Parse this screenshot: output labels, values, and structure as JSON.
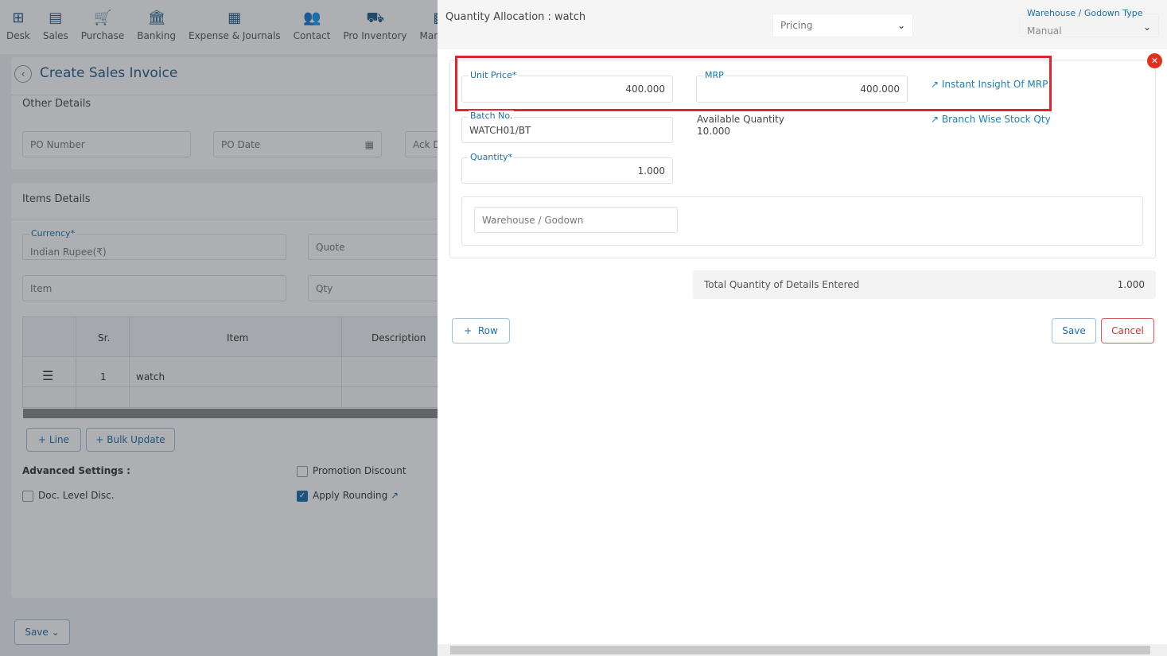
{
  "nav": [
    {
      "label": "Desk",
      "icon": "grid-plus-icon",
      "g": "⊞"
    },
    {
      "label": "Sales",
      "icon": "receipt-icon",
      "g": "▤"
    },
    {
      "label": "Purchase",
      "icon": "cart-icon",
      "g": "🛒"
    },
    {
      "label": "Banking",
      "icon": "bank-icon",
      "g": "🏛"
    },
    {
      "label": "Expense & Journals",
      "icon": "notebook-icon",
      "g": "▦"
    },
    {
      "label": "Contact",
      "icon": "users-icon",
      "g": "👥"
    },
    {
      "label": "Pro Inventory",
      "icon": "trolley-icon",
      "g": "⛟"
    },
    {
      "label": "Manufac",
      "icon": "factory-icon",
      "g": "▩"
    }
  ],
  "page": {
    "title": "Create Sales Invoice",
    "other_details": "Other Details",
    "po_number": "PO Number",
    "po_date": "PO Date",
    "ack": "Ack D",
    "items_details": "Items Details",
    "currency_label": "Currency",
    "currency_value": "Indian Rupee(₹)",
    "quote": "Quote",
    "item": "Item",
    "qty": "Qty",
    "table": {
      "headers": [
        "Sr.",
        "Item",
        "Description"
      ],
      "rows": [
        {
          "sr": "1",
          "item": "watch"
        }
      ]
    },
    "line_btn": "Line",
    "bulk_btn": "Bulk Update",
    "advanced": "Advanced Settings :",
    "promotion": "Promotion Discount",
    "doc_disc": "Doc. Level Disc.",
    "rounding": "Apply Rounding",
    "rounding_checked": true,
    "save": "Save"
  },
  "modal": {
    "title": "Quantity Allocation : watch",
    "pricing": "Pricing",
    "wh_type_label": "Warehouse / Godown Type",
    "wh_type_value": "Manual",
    "unit_price_label": "Unit Price",
    "unit_price": "400.000",
    "mrp_label": "MRP",
    "mrp": "400.000",
    "insight_link": "Instant Insight Of MRP",
    "batch_label": "Batch No.",
    "batch": "WATCH01/BT",
    "avail_label": "Available Quantity",
    "avail": "10.000",
    "branch_link": "Branch Wise Stock Qty",
    "qty_label": "Quantity",
    "qty": "1.000",
    "warehouse_placeholder": "Warehouse / Godown",
    "total_label": "Total Quantity of Details Entered",
    "total": "1.000",
    "row_btn": "Row",
    "save": "Save",
    "cancel": "Cancel",
    "highlight_color": "#e0252f"
  }
}
